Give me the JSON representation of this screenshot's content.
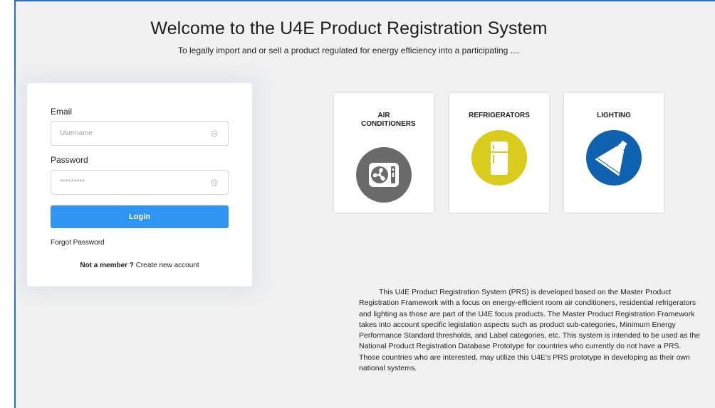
{
  "header": {
    "title": "Welcome to the U4E Product Registration System",
    "subtitle": "To legally import and or sell a product regulated for energy efficiency into a participating ...."
  },
  "login": {
    "email_label": "Email",
    "email_placeholder": "Username",
    "password_label": "Password",
    "password_placeholder": "*********",
    "login_button": "Login",
    "forgot_password": "Forgot Password",
    "not_member": "Not a member ?",
    "create_account": "Create new account"
  },
  "products": [
    {
      "label": "AIR CONDITIONERS",
      "icon": "air-conditioner-icon",
      "color": "#6a6a6a"
    },
    {
      "label": "REFRIGERATORS",
      "icon": "refrigerator-icon",
      "color": "#dacc1c"
    },
    {
      "label": "LIGHTING",
      "icon": "lamp-icon",
      "color": "#0e62b0"
    }
  ],
  "description": "This U4E Product Registration System (PRS) is developed based on the Master Product Registration Framework with a focus on energy-efficient room air conditioners, residential refrigerators and lighting as those are part of the U4E focus products. The Master Product Registration Framework takes into account specific legislation aspects such as product sub-categories, Minimum Energy Performance Standard thresholds, and Label categories, etc. This system is intended to be used as the National Product Registration Database Prototype for countries who currently do not have a PRS. Those countries who are interested, may utilize this U4E's PRS prototype in developing as their own national systems.",
  "colors": {
    "accent": "#2f95f2",
    "frame_border": "#2c6fb6",
    "background": "#f1f1f1"
  }
}
